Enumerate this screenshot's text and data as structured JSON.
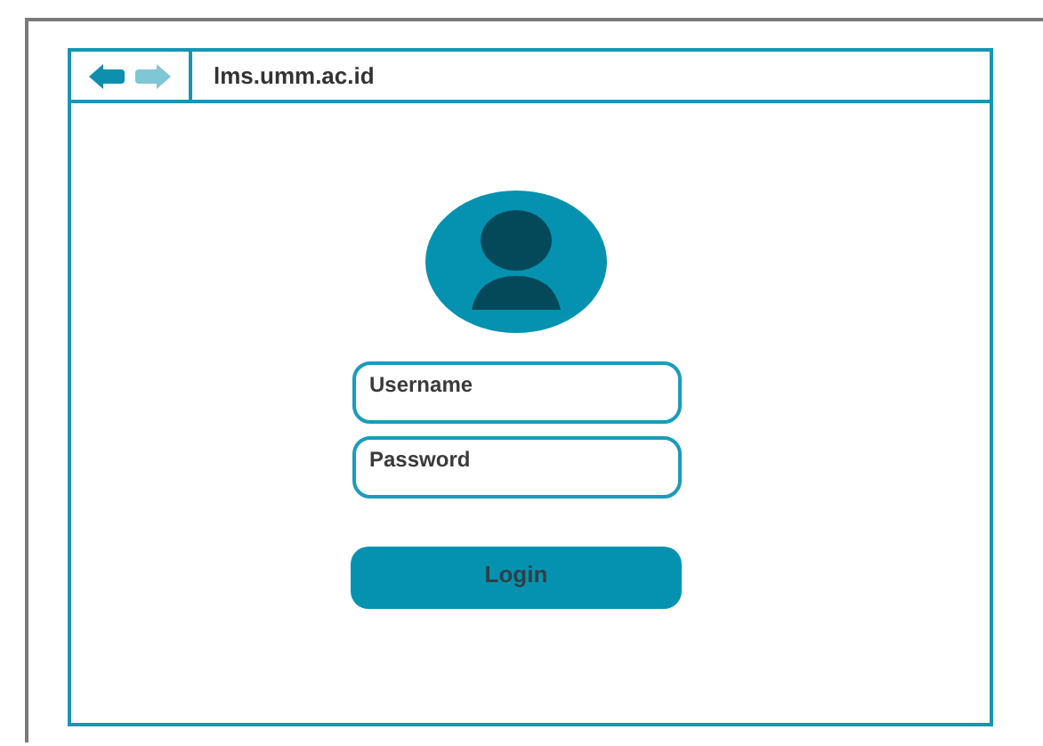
{
  "browser": {
    "back_button": {
      "disabled": false
    },
    "forward_button": {
      "disabled": true
    },
    "address": "lms.umm.ac.id"
  },
  "login_form": {
    "fields": [
      {
        "placeholder": "Username"
      },
      {
        "placeholder": "Password"
      }
    ],
    "button": "Login"
  }
}
